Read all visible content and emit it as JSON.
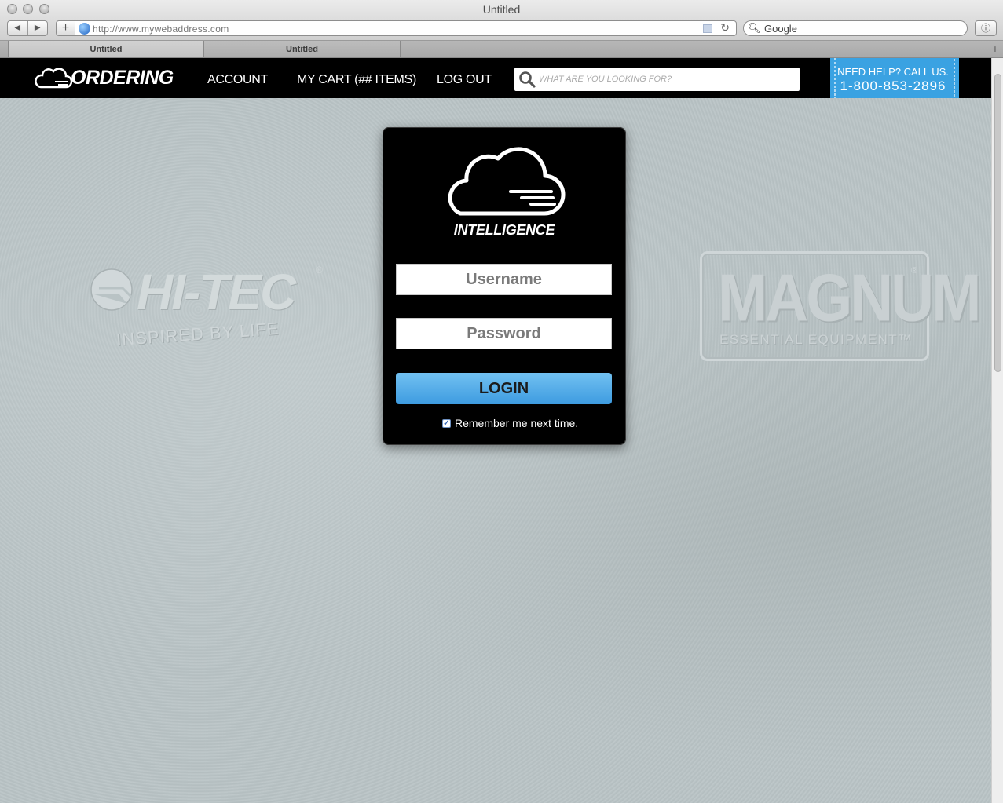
{
  "window": {
    "title": "Untitled"
  },
  "browser": {
    "url": "http://www.mywebaddress.com",
    "search_value": "Google",
    "tabs": [
      {
        "label": "Untitled"
      },
      {
        "label": "Untitled"
      }
    ]
  },
  "header": {
    "brand": "ORDERING",
    "nav": [
      {
        "label": "ACCOUNT"
      },
      {
        "label": "MY CART (## ITEMS)"
      },
      {
        "label": "LOG OUT"
      }
    ],
    "search_placeholder": "WHAT ARE YOU LOOKING FOR?",
    "help": {
      "line1": "NEED HELP? CALL US.",
      "phone": "1-800-853-2896"
    }
  },
  "brands": {
    "left": {
      "name": "HI-TEC",
      "tagline": "INSPIRED BY LIFE",
      "mark": "®"
    },
    "right": {
      "name": "MAGNUM",
      "tagline": "ESSENTIAL EQUIPMENT",
      "mark": "®",
      "tm": "™"
    }
  },
  "login": {
    "brand": "INTELLIGENCE",
    "username_placeholder": "Username",
    "password_placeholder": "Password",
    "button": "LOGIN",
    "remember_label": "Remember me next time.",
    "remember_checked": true
  },
  "colors": {
    "accent": "#4aa8e8",
    "header_bg": "#000000",
    "panel_bg": "#000000"
  }
}
